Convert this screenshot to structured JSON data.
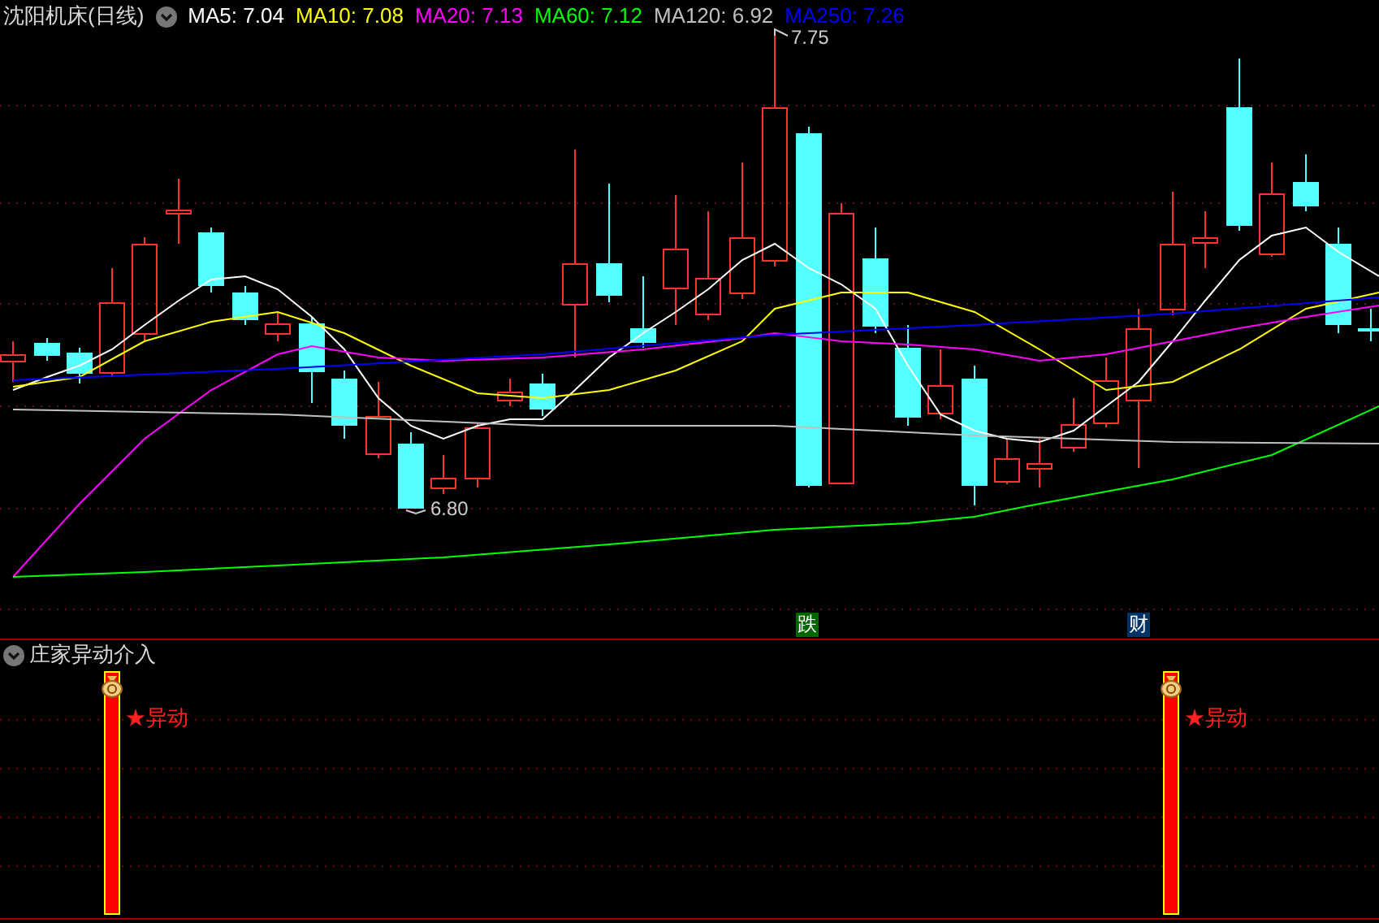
{
  "chart_header": {
    "title": "沈阳机床(日线)",
    "legend": [
      {
        "label": "MA5: 7.04",
        "color": "#ffffff"
      },
      {
        "label": "MA10: 7.08",
        "color": "#ffff00"
      },
      {
        "label": "MA20: 7.13",
        "color": "#ff00ff"
      },
      {
        "label": "MA60: 7.12",
        "color": "#00ff00"
      },
      {
        "label": "MA120: 6.92",
        "color": "#c0c0c0"
      },
      {
        "label": "MA250: 7.26",
        "color": "#0000ff"
      }
    ]
  },
  "price_labels": [
    {
      "text": "7.75"
    },
    {
      "text": "6.80"
    }
  ],
  "markers": [
    {
      "text": "跌",
      "color": "#006600"
    },
    {
      "text": "财",
      "color": "#003366"
    }
  ],
  "indicator": {
    "title": "庄家异动介入",
    "signals": [
      {
        "text": "★异动"
      },
      {
        "text": "★异动"
      }
    ]
  }
}
